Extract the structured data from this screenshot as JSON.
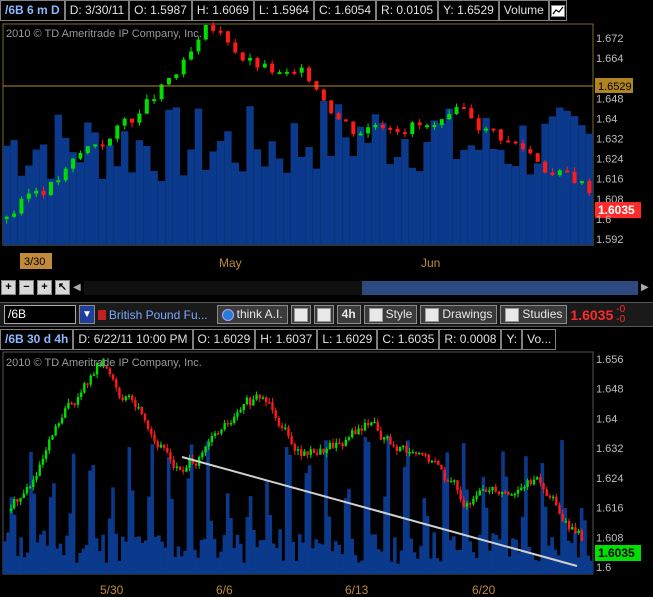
{
  "top_chart": {
    "header": {
      "symbol": "/6B 6 m D",
      "date": "D: 3/30/11",
      "open": "O: 1.5987",
      "high": "H: 1.6069",
      "low": "L: 1.5964",
      "close": "C: 1.6054",
      "range": "R: 0.0105",
      "y": "Y: 1.6529",
      "volume": "Volume"
    },
    "copyright": "2010 © TD Ameritrade IP Company, Inc.",
    "y_labels": [
      "1.672",
      "1.664",
      "1.6529",
      "1.648",
      "1.64",
      "1.632",
      "1.624",
      "1.616",
      "1.608",
      "1.6035",
      "1.6",
      "1.592"
    ],
    "cursor_price": "1.6529",
    "last_price": "1.6035",
    "x_labels": [
      "May",
      "Jun"
    ],
    "date_marker": "3/30",
    "colors": {
      "up": "#00dd00",
      "down": "#ff1a1a",
      "volume": "#0b3a8c",
      "cursor": "#b78a2a",
      "last": "#ff2b2b"
    }
  },
  "toolbar": {
    "symbol": "/6B",
    "description": "British Pound Fu...",
    "think_ai": "think A.I.",
    "aggregation": "4h",
    "style": "Style",
    "drawings": "Drawings",
    "studies": "Studies",
    "price": "1.6035",
    "change_top": "-0",
    "change_bottom": "-0"
  },
  "bottom_chart": {
    "header": {
      "symbol": "/6B 30 d 4h",
      "date": "D: 6/22/11 10:00 PM",
      "open": "O: 1.6029",
      "high": "H: 1.6037",
      "low": "L: 1.6029",
      "close": "C: 1.6035",
      "range": "R: 0.0008",
      "y": "Y:",
      "volume": "Vo..."
    },
    "copyright": "2010 © TD Ameritrade IP Company, Inc.",
    "y_labels": [
      "1.656",
      "1.648",
      "1.64",
      "1.632",
      "1.624",
      "1.616",
      "1.608",
      "1.6035",
      "1.6"
    ],
    "last_price": "1.6035",
    "x_labels": [
      "5/30",
      "6/6",
      "6/13",
      "6/20"
    ],
    "colors": {
      "up": "#00dd00",
      "down": "#ff1a1a",
      "volume": "#0b3a8c",
      "last": "#00e000",
      "trendline": "#d0d0d0"
    }
  }
}
